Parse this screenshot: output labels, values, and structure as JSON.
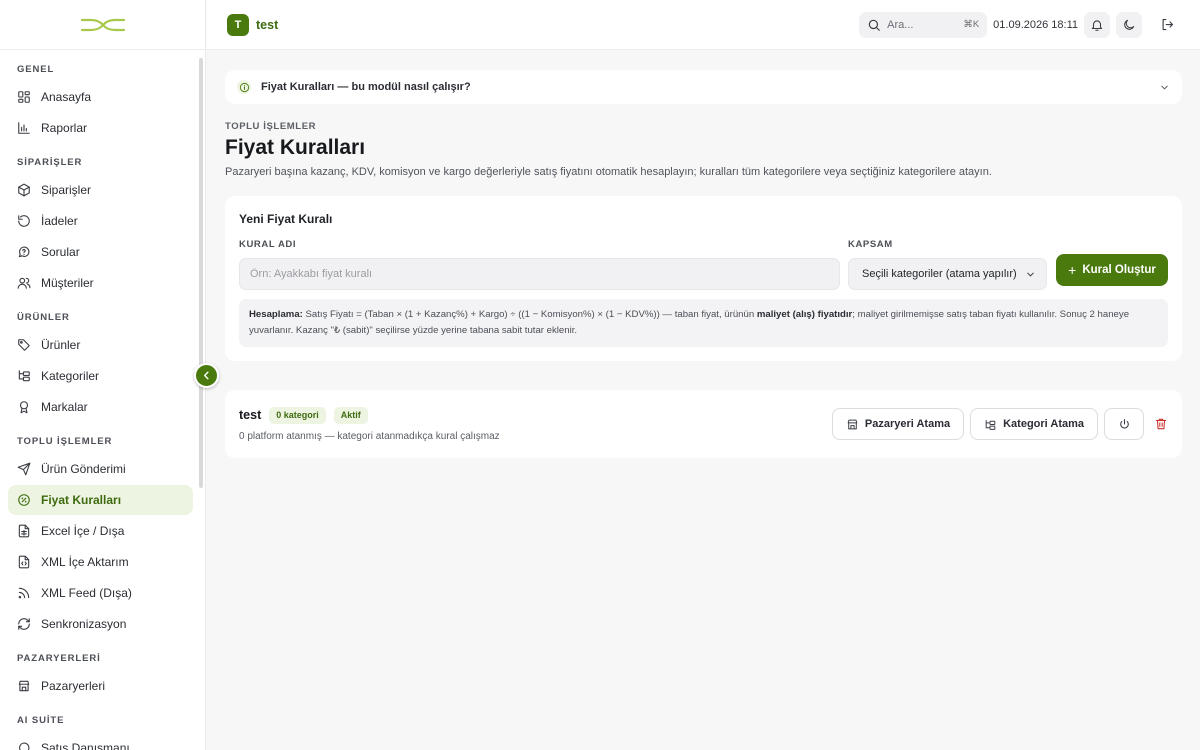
{
  "sidebar": {
    "sections": [
      {
        "title": "GENEL",
        "items": [
          {
            "label": "Anasayfa",
            "icon": "dashboard-icon"
          },
          {
            "label": "Raporlar",
            "icon": "bar-chart-icon"
          }
        ]
      },
      {
        "title": "SİPARİŞLER",
        "items": [
          {
            "label": "Siparişler",
            "icon": "package-icon"
          },
          {
            "label": "İadeler",
            "icon": "rotate-ccw-icon"
          },
          {
            "label": "Sorular",
            "icon": "message-question-icon"
          },
          {
            "label": "Müşteriler",
            "icon": "users-icon"
          }
        ]
      },
      {
        "title": "ÜRÜNLER",
        "items": [
          {
            "label": "Ürünler",
            "icon": "tag-icon"
          },
          {
            "label": "Kategoriler",
            "icon": "folder-tree-icon"
          },
          {
            "label": "Markalar",
            "icon": "award-icon"
          }
        ]
      },
      {
        "title": "TOPLU İŞLEMLER",
        "items": [
          {
            "label": "Ürün Gönderimi",
            "icon": "send-icon"
          },
          {
            "label": "Fiyat Kuralları",
            "icon": "badge-percent-icon",
            "active": true
          },
          {
            "label": "Excel İçe / Dışa",
            "icon": "file-spreadsheet-icon"
          },
          {
            "label": "XML İçe Aktarım",
            "icon": "file-code-icon"
          },
          {
            "label": "XML Feed (Dışa)",
            "icon": "rss-icon"
          },
          {
            "label": "Senkronizasyon",
            "icon": "refresh-icon"
          }
        ]
      },
      {
        "title": "PAZARYERLERİ",
        "items": [
          {
            "label": "Pazaryerleri",
            "icon": "store-icon"
          }
        ]
      },
      {
        "title": "AI SUİTE",
        "items": [
          {
            "label": "Satış Danışmanı",
            "icon": "chat-icon"
          }
        ]
      }
    ]
  },
  "topbar": {
    "workspace_initial": "T",
    "workspace_name": "test",
    "search_placeholder": "Ara...",
    "search_shortcut": "⌘K",
    "datetime": "01.09.2026 18:11"
  },
  "help": {
    "label": "Fiyat Kuralları — bu modül nasıl çalışır?"
  },
  "page": {
    "eyebrow": "TOPLU İŞLEMLER",
    "title": "Fiyat Kuralları",
    "description": "Pazaryeri başına kazanç, KDV, komisyon ve kargo değerleriyle satış fiyatını otomatik hesaplayın; kuralları tüm kategorilere veya seçtiğiniz kategorilere atayın."
  },
  "new_rule": {
    "title": "Yeni Fiyat Kuralı",
    "name_label": "KURAL ADI",
    "name_placeholder": "Örn: Ayakkabı fiyat kuralı",
    "name_value": "",
    "scope_label": "KAPSAM",
    "scope_value": "Seçili kategoriler (atama yapılır)",
    "create_label": "Kural Oluştur",
    "calc_title": "Hesaplama:",
    "calc_part1": " Satış Fiyatı = (Taban × (1 + Kazanç%) + Kargo) ÷ ((1 − Komisyon%) × (1 − KDV%)) — taban fiyat, ürünün ",
    "calc_bold": "maliyet (alış) fiyatıdır",
    "calc_part2": "; maliyet girilmemişse satış taban fiyatı kullanılır. Sonuç 2 haneye yuvarlanır. Kazanç \"₺ (sabit)\" seçilirse yüzde yerine tabana sabit tutar eklenir."
  },
  "rules": [
    {
      "name": "test",
      "category_badge": "0 kategori",
      "status_badge": "Aktif",
      "subtitle": "0 platform atanmış — kategori atanmadıkça kural çalışmaz",
      "marketplace_btn": "Pazaryeri Atama",
      "category_btn": "Kategori Atama"
    }
  ],
  "colors": {
    "accent": "#4a7a0e",
    "accent_soft": "#eef4e2",
    "danger": "#c9302c",
    "logo": "#a8c84a"
  }
}
